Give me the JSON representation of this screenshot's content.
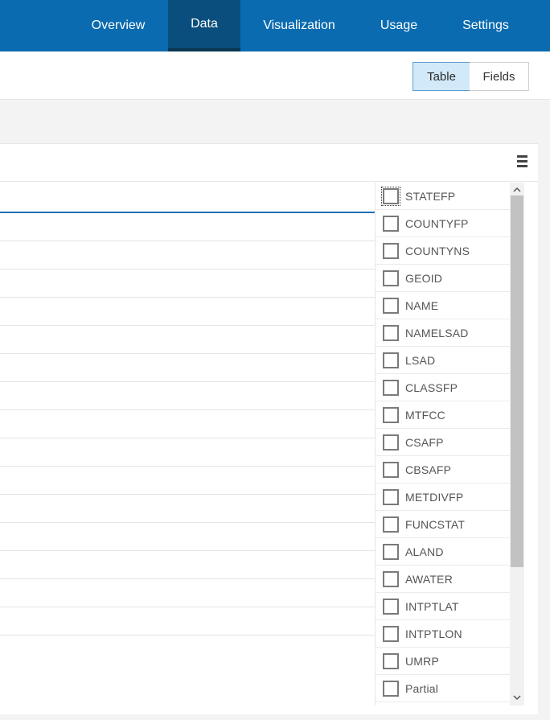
{
  "nav": {
    "tabs": [
      {
        "label": "Overview"
      },
      {
        "label": "Data"
      },
      {
        "label": "Visualization"
      },
      {
        "label": "Usage"
      },
      {
        "label": "Settings"
      }
    ],
    "active_tab": "Data"
  },
  "toolbar": {
    "table_label": "Table",
    "fields_label": "Fields",
    "selected_view": "Table"
  },
  "table": {
    "menu_icon": "hamburger-menu-icon",
    "visible_row_count": 15
  },
  "field_list": {
    "items": [
      {
        "label": "STATEFP",
        "checked": false
      },
      {
        "label": "COUNTYFP",
        "checked": false
      },
      {
        "label": "COUNTYNS",
        "checked": false
      },
      {
        "label": "GEOID",
        "checked": false
      },
      {
        "label": "NAME",
        "checked": false
      },
      {
        "label": "NAMELSAD",
        "checked": false
      },
      {
        "label": "LSAD",
        "checked": false
      },
      {
        "label": "CLASSFP",
        "checked": false
      },
      {
        "label": "MTFCC",
        "checked": false
      },
      {
        "label": "CSAFP",
        "checked": false
      },
      {
        "label": "CBSAFP",
        "checked": false
      },
      {
        "label": "METDIVFP",
        "checked": false
      },
      {
        "label": "FUNCSTAT",
        "checked": false
      },
      {
        "label": "ALAND",
        "checked": false
      },
      {
        "label": "AWATER",
        "checked": false
      },
      {
        "label": "INTPTLAT",
        "checked": false
      },
      {
        "label": "INTPTLON",
        "checked": false
      },
      {
        "label": "UMRP",
        "checked": false
      },
      {
        "label": "Partial",
        "checked": false
      }
    ]
  },
  "scroll": {
    "up_icon": "chevron-up-icon",
    "down_icon": "chevron-down-icon"
  },
  "colors": {
    "nav_bg": "#0a6bb0",
    "nav_active": "#094e7c",
    "selected_button_bg": "#d2e9f9",
    "table_header_underline": "#1f6fb3"
  }
}
